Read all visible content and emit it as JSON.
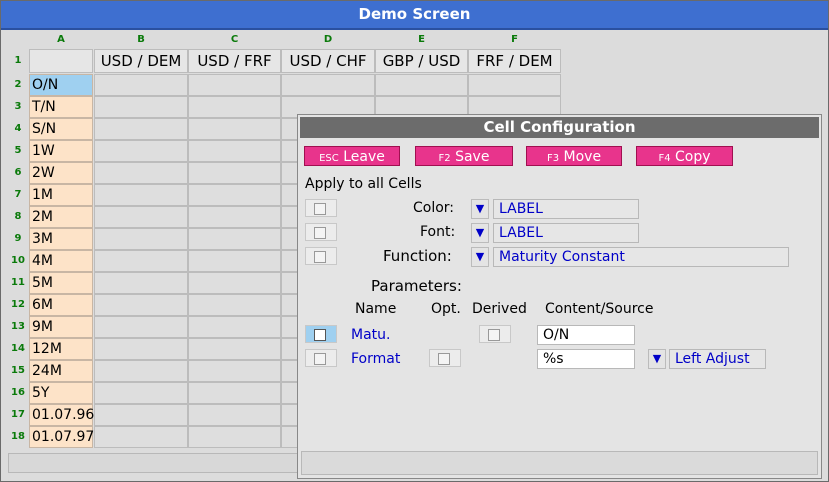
{
  "window": {
    "title": "Demo Screen"
  },
  "sheet": {
    "col_letters": [
      "A",
      "B",
      "C",
      "D",
      "E",
      "F"
    ],
    "col_headers": [
      "",
      "USD / DEM",
      "USD / FRF",
      "USD / CHF",
      "GBP / USD",
      "FRF / DEM"
    ],
    "row_numbers": [
      "1",
      "2",
      "3",
      "4",
      "5",
      "6",
      "7",
      "8",
      "9",
      "10",
      "11",
      "12",
      "13",
      "14",
      "15",
      "16",
      "17",
      "18"
    ],
    "row_labels": [
      "O/N",
      "T/N",
      "S/N",
      "1W",
      "2W",
      "1M",
      "2M",
      "3M",
      "4M",
      "5M",
      "6M",
      "9M",
      "12M",
      "24M",
      "5Y",
      "01.07.96",
      "01.07.97"
    ],
    "selected_row_label": "O/N"
  },
  "dialog": {
    "title": "Cell Configuration",
    "buttons": [
      {
        "key": "ESC",
        "label": "Leave"
      },
      {
        "key": "F2",
        "label": "Save"
      },
      {
        "key": "F3",
        "label": "Move"
      },
      {
        "key": "F4",
        "label": "Copy"
      }
    ],
    "apply_all_label": "Apply to all Cells",
    "color_label": "Color:",
    "color_value": "LABEL",
    "font_label": "Font:",
    "font_value": "LABEL",
    "function_label": "Function:",
    "function_value": "Maturity Constant",
    "parameters_label": "Parameters:",
    "param_headers": {
      "name": "Name",
      "opt": "Opt.",
      "derived": "Derived",
      "content": "Content/Source"
    },
    "params": [
      {
        "name": "Matu.",
        "content": "O/N"
      },
      {
        "name": "Format",
        "content": "%s",
        "adjust": "Left Adjust"
      }
    ]
  },
  "colors": {
    "title_bar": "#3e6fd0",
    "button": "#e8348c",
    "label_cell": "#fde3c8",
    "selection": "#9fd0f0",
    "dialog_title": "#6c6c6c"
  },
  "icons": {
    "dropdown": "triangle-down-icon",
    "checkbox": "checkbox-icon"
  }
}
